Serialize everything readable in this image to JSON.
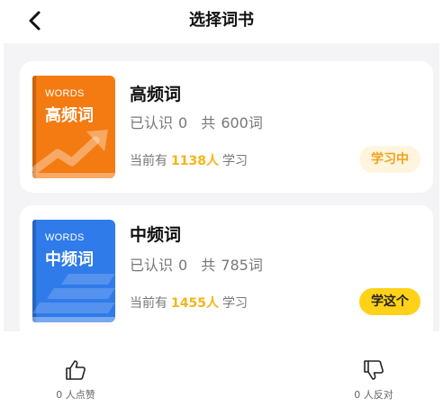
{
  "nav": {
    "title": "选择词书",
    "back_icon": "chevron-left-icon"
  },
  "books": [
    {
      "name": "高频词",
      "cover_en": "WORDS",
      "cover_zh": "高频词",
      "cover_color": "#f47b12",
      "known_prefix": "已认识",
      "known_count": "0",
      "total_prefix": "共",
      "total_count": "600",
      "total_unit": "词",
      "learners_prefix": "当前有",
      "learners_count": "1138人",
      "learners_suffix": "学习",
      "action_label": "学习中"
    },
    {
      "name": "中频词",
      "cover_en": "WORDS",
      "cover_zh": "中频词",
      "cover_color": "#2f7bea",
      "known_prefix": "已认识",
      "known_count": "0",
      "total_prefix": "共",
      "total_count": "785",
      "total_unit": "词",
      "learners_prefix": "当前有",
      "learners_count": "1455人",
      "learners_suffix": "学习",
      "action_label": "学这个"
    }
  ],
  "feedback": {
    "like_label": "0 人点赞",
    "dislike_label": "0 人反对",
    "like_icon": "thumbs-up-icon",
    "dislike_icon": "thumbs-down-icon"
  },
  "colors": {
    "accent_yellow": "#ffd219",
    "count_yellow": "#f3b51a",
    "studying_bg": "#fff5df"
  }
}
